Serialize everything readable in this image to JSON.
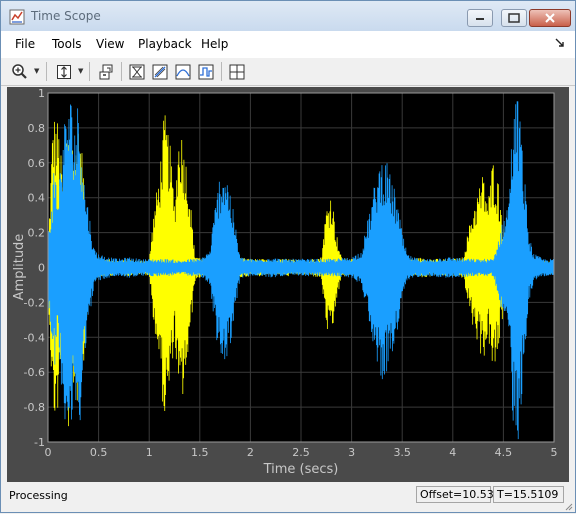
{
  "window": {
    "title": "Time Scope",
    "icon": "matlab-figure-icon"
  },
  "menu": {
    "items": [
      "File",
      "Tools",
      "View",
      "Playback",
      "Help"
    ],
    "pin_icon": "dock-arrow-icon"
  },
  "toolbar": {
    "icons": [
      "zoom-in-icon",
      "scale-axes-icon",
      "highlight-simulink-icon",
      "triggers-icon",
      "cursor-measurements-icon",
      "signal-statistics-icon",
      "peak-finder-icon",
      "layout-icon"
    ]
  },
  "plot": {
    "ylabel": "Amplitude",
    "xlabel": "Time (secs)",
    "xticks": [
      "0",
      "0.5",
      "1",
      "1.5",
      "2",
      "2.5",
      "3",
      "3.5",
      "4",
      "4.5",
      "5"
    ],
    "yticks": [
      "1",
      "0.8",
      "0.6",
      "0.4",
      "0.2",
      "0",
      "-0.2",
      "-0.4",
      "-0.6",
      "-0.8",
      "-1"
    ],
    "background": "#000000",
    "axis_color": "#4a4a4a",
    "series_colors": [
      "#ffff00",
      "#1a9fff"
    ]
  },
  "chart_data": {
    "type": "line",
    "xlabel": "Time (secs)",
    "ylabel": "Amplitude",
    "xlim": [
      0,
      5
    ],
    "ylim": [
      -1,
      1
    ],
    "grid": true,
    "series": [
      {
        "color": "#ffff00",
        "envelope": {
          "x": [
            0,
            0.05,
            0.1,
            0.15,
            0.2,
            0.25,
            0.3,
            0.35,
            0.4,
            0.45,
            0.5,
            0.55,
            0.6,
            0.7,
            0.8,
            0.9,
            1.0,
            1.05,
            1.1,
            1.15,
            1.2,
            1.25,
            1.3,
            1.35,
            1.4,
            1.45,
            1.5,
            1.6,
            1.7,
            1.75,
            1.8,
            1.9,
            2.0,
            2.1,
            2.2,
            2.3,
            2.4,
            2.5,
            2.6,
            2.7,
            2.75,
            2.8,
            2.85,
            2.9,
            2.95,
            3.0,
            3.1,
            3.2,
            3.3,
            3.4,
            3.5,
            3.6,
            3.7,
            3.8,
            3.9,
            4.0,
            4.1,
            4.2,
            4.3,
            4.35,
            4.4,
            4.45,
            4.5,
            4.55,
            4.6,
            4.65,
            4.7,
            4.75,
            4.8,
            4.9,
            5.0
          ],
          "amplitude": [
            0.1,
            0.9,
            0.85,
            0.5,
            0.95,
            0.7,
            0.8,
            0.6,
            0.15,
            0.08,
            0.06,
            0.05,
            0.05,
            0.04,
            0.05,
            0.04,
            0.05,
            0.35,
            0.55,
            0.9,
            0.75,
            0.4,
            0.85,
            0.7,
            0.45,
            0.08,
            0.06,
            0.05,
            0.05,
            0.1,
            0.1,
            0.06,
            0.05,
            0.05,
            0.04,
            0.05,
            0.05,
            0.04,
            0.05,
            0.06,
            0.35,
            0.45,
            0.2,
            0.06,
            0.05,
            0.05,
            0.05,
            0.05,
            0.06,
            0.05,
            0.05,
            0.05,
            0.06,
            0.05,
            0.05,
            0.05,
            0.06,
            0.35,
            0.55,
            0.4,
            0.65,
            0.5,
            0.25,
            0.08,
            0.06,
            0.06,
            0.05,
            0.05,
            0.05,
            0.04,
            0.04
          ]
        }
      },
      {
        "color": "#1a9fff",
        "envelope": {
          "x": [
            0,
            0.03,
            0.06,
            0.1,
            0.15,
            0.2,
            0.22,
            0.25,
            0.28,
            0.3,
            0.33,
            0.36,
            0.4,
            0.45,
            0.5,
            0.6,
            0.7,
            0.8,
            0.9,
            1.0,
            1.1,
            1.2,
            1.3,
            1.4,
            1.5,
            1.6,
            1.65,
            1.7,
            1.75,
            1.8,
            1.85,
            1.9,
            2.0,
            2.1,
            2.2,
            2.3,
            2.4,
            2.5,
            2.6,
            2.8,
            3.0,
            3.1,
            3.2,
            3.25,
            3.3,
            3.35,
            3.4,
            3.45,
            3.5,
            3.55,
            3.6,
            3.7,
            3.8,
            3.9,
            4.0,
            4.2,
            4.4,
            4.55,
            4.6,
            4.65,
            4.7,
            4.75,
            4.8,
            4.9,
            5.0
          ],
          "amplitude": [
            0.2,
            0.35,
            0.6,
            0.45,
            0.8,
            1.0,
            1.0,
            0.9,
            0.85,
            1.0,
            0.8,
            0.5,
            0.35,
            0.12,
            0.08,
            0.06,
            0.05,
            0.06,
            0.05,
            0.05,
            0.05,
            0.05,
            0.04,
            0.05,
            0.05,
            0.1,
            0.35,
            0.55,
            0.6,
            0.45,
            0.25,
            0.06,
            0.05,
            0.05,
            0.06,
            0.05,
            0.05,
            0.05,
            0.05,
            0.05,
            0.06,
            0.1,
            0.4,
            0.55,
            0.65,
            0.6,
            0.5,
            0.4,
            0.2,
            0.08,
            0.06,
            0.05,
            0.05,
            0.06,
            0.06,
            0.05,
            0.05,
            0.4,
            0.95,
            1.0,
            0.6,
            0.2,
            0.08,
            0.05,
            0.05
          ]
        }
      }
    ]
  },
  "status": {
    "text": "Processing",
    "offset": "Offset=10.534",
    "time": "T=15.5109"
  }
}
